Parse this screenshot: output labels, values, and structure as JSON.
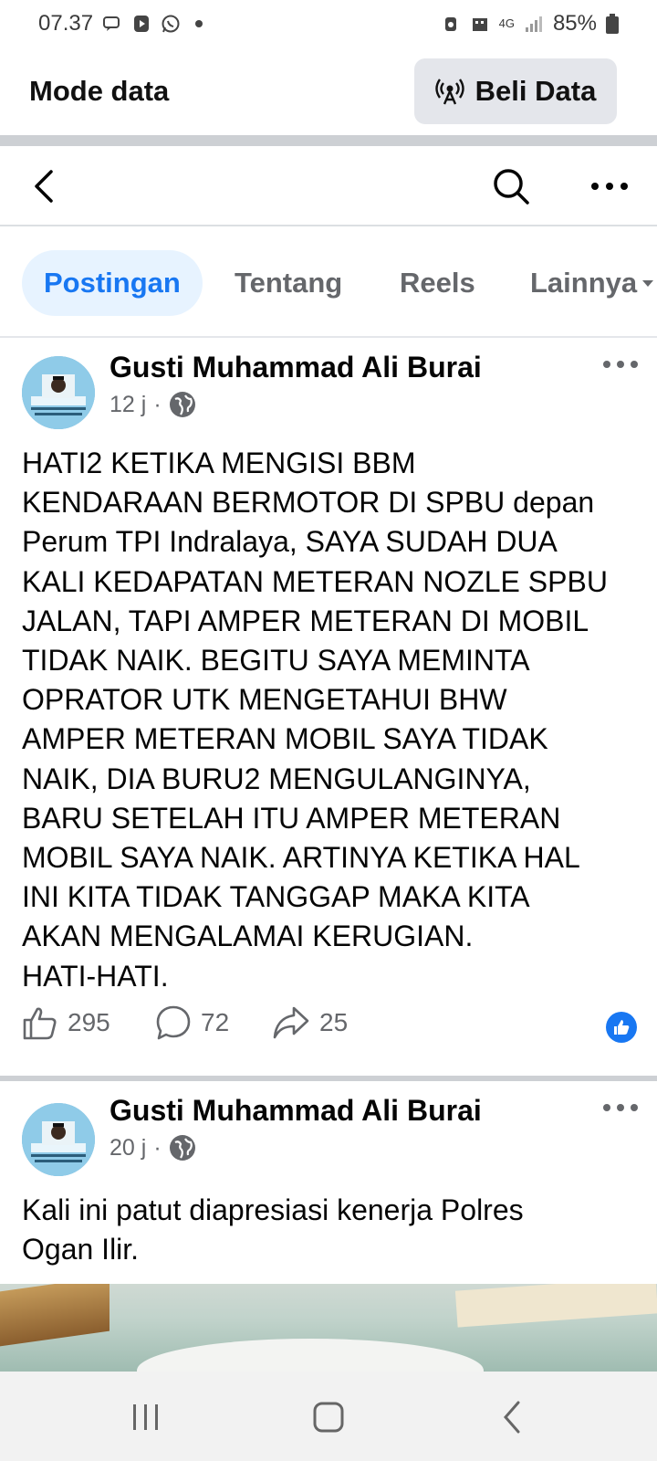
{
  "status_bar": {
    "time": "07.37",
    "network": "4G",
    "battery": "85%"
  },
  "data_banner": {
    "title": "Mode data",
    "buy_button_label": "Beli Data"
  },
  "tabs": [
    {
      "label": "Postingan",
      "active": true
    },
    {
      "label": "Tentang",
      "active": false
    },
    {
      "label": "Reels",
      "active": false
    },
    {
      "label": "Lainnya",
      "active": false
    }
  ],
  "posts": [
    {
      "author": "Gusti Muhammad Ali Burai",
      "time": "12 j",
      "privacy_icon": "globe-icon",
      "text": "HATI2 KETIKA MENGISI BBM\nKENDARAAN BERMOTOR DI SPBU depan\nPerum TPI Indralaya, SAYA SUDAH DUA\nKALI KEDAPATAN METERAN NOZLE SPBU\nJALAN, TAPI AMPER METERAN DI MOBIL\nTIDAK NAIK. BEGITU SAYA MEMINTA\nOPRATOR UTK MENGETAHUI BHW\nAMPER METERAN MOBIL SAYA TIDAK\nNAIK, DIA BURU2 MENGULANGINYA,\nBARU SETELAH ITU AMPER METERAN\nMOBIL SAYA NAIK. ARTINYA KETIKA HAL\nINI KITA TIDAK TANGGAP MAKA KITA\nAKAN MENGALAMAI KERUGIAN.\nHATI-HATI.",
      "likes": "295",
      "comments": "72",
      "shares": "25"
    },
    {
      "author": "Gusti Muhammad Ali Burai",
      "time": "20 j",
      "privacy_icon": "globe-icon",
      "text": "Kali ini patut diapresiasi kenerja Polres\nOgan Ilir."
    }
  ],
  "colors": {
    "accent": "#1877f2",
    "active_tab_bg": "#e7f3ff",
    "secondary_text": "#65676b",
    "separator": "#cdd0d4"
  }
}
